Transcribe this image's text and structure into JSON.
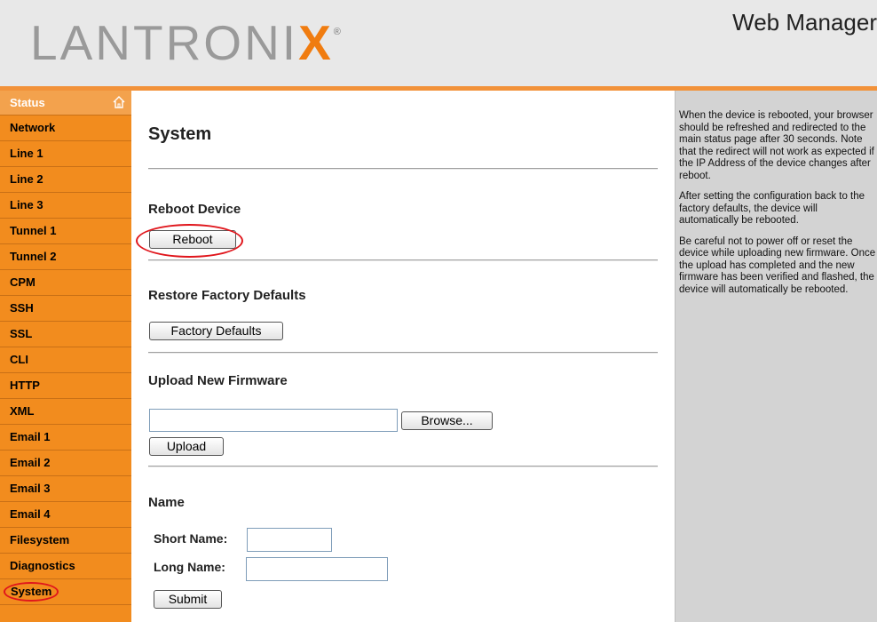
{
  "header": {
    "logo_prefix": "LANTRONI",
    "logo_x": "X",
    "logo_reg": "®",
    "title": "Web Manager"
  },
  "sidebar": {
    "items": [
      {
        "label": "Status",
        "icon": "home-icon"
      },
      {
        "label": "Network"
      },
      {
        "label": "Line 1"
      },
      {
        "label": "Line 2"
      },
      {
        "label": "Line 3"
      },
      {
        "label": "Tunnel 1"
      },
      {
        "label": "Tunnel 2"
      },
      {
        "label": "CPM"
      },
      {
        "label": "SSH"
      },
      {
        "label": "SSL"
      },
      {
        "label": "CLI"
      },
      {
        "label": "HTTP"
      },
      {
        "label": "XML"
      },
      {
        "label": "Email 1"
      },
      {
        "label": "Email 2"
      },
      {
        "label": "Email 3"
      },
      {
        "label": "Email 4"
      },
      {
        "label": "Filesystem"
      },
      {
        "label": "Diagnostics"
      },
      {
        "label": "System",
        "active": true
      }
    ]
  },
  "main": {
    "title": "System",
    "reboot": {
      "heading": "Reboot Device",
      "button": "Reboot"
    },
    "factory": {
      "heading": "Restore Factory Defaults",
      "button": "Factory Defaults"
    },
    "firmware": {
      "heading": "Upload New Firmware",
      "file_value": "",
      "browse_button": "Browse...",
      "upload_button": "Upload"
    },
    "name": {
      "heading": "Name",
      "short_label": "Short Name:",
      "short_value": "",
      "long_label": "Long Name:",
      "long_value": "",
      "submit_button": "Submit"
    }
  },
  "help": {
    "paragraphs": [
      "When the device is rebooted, your browser should be refreshed and redirected to the main status page after 30 seconds. Note that the redirect will not work as expected if the IP Address of the device changes after reboot.",
      "After setting the configuration back to the factory defaults, the device will automatically be rebooted.",
      "Be careful not to power off or reset the device while uploading new firmware. Once the upload has completed and the new firmware has been verified and flashed, the device will automatically be rebooted."
    ]
  },
  "colors": {
    "accent": "#f28c1e",
    "highlight_ring": "#e0161c",
    "help_bg": "#d3d3d3"
  }
}
